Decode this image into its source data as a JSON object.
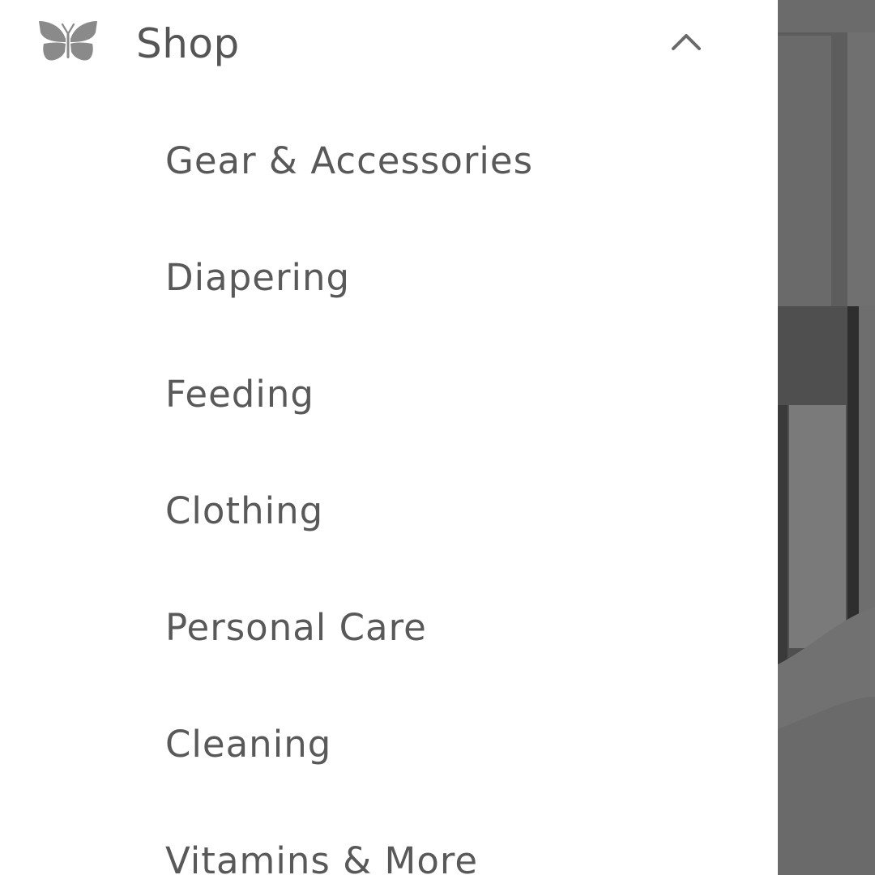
{
  "menu": {
    "section_title": "Shop",
    "expanded": true,
    "logo_icon": "butterfly-icon",
    "toggle_icon": "chevron-up-icon",
    "items": [
      {
        "label": "Gear & Accessories"
      },
      {
        "label": "Diapering"
      },
      {
        "label": "Feeding"
      },
      {
        "label": "Clothing"
      },
      {
        "label": "Personal Care"
      },
      {
        "label": "Cleaning"
      },
      {
        "label": "Vitamins & More"
      }
    ]
  },
  "colors": {
    "text": "#555555",
    "icon": "#8a8a8a",
    "overlay": "#5a5a5a"
  }
}
